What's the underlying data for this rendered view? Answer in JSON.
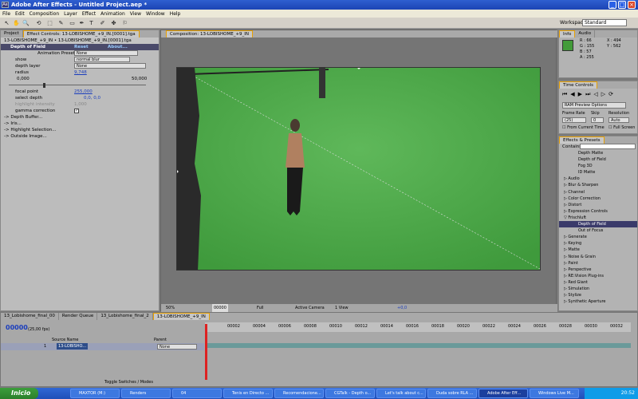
{
  "app": {
    "title": "Adobe After Effects - Untitled Project.aep *"
  },
  "window_buttons": {
    "minimize": "_",
    "maximize": "□",
    "close": "×"
  },
  "menu": [
    "File",
    "Edit",
    "Composition",
    "Layer",
    "Effect",
    "Animation",
    "View",
    "Window",
    "Help"
  ],
  "toolbar": {
    "tools": [
      "↖",
      "✋",
      "🔍",
      "⟲",
      "⬚",
      "✎",
      "▭",
      "✒",
      "T",
      "✐",
      "✤",
      "⚐"
    ],
    "workspace_label": "Workspace:",
    "workspace_value": "Standard"
  },
  "project_panel": {
    "tab_project": "Project",
    "tab_effect_controls": "Effect Controls: 13-LOBISHOME_+9_IN.[0001].tga",
    "breadcrumb": "13-LOBISHOME_+9_IN • 13-LOBISHOME_+9_IN.[0001].tga",
    "effect_name": "Depth of Field",
    "reset": "Reset",
    "about": "About...",
    "animation_presets_label": "Animation Presets:",
    "animation_presets_value": "None",
    "show_label": "show",
    "show_value": "normal blur",
    "depth_layer_label": "depth layer",
    "depth_layer_value": "None",
    "radius_label": "radius",
    "radius_value": "9,748",
    "radius_min": "0,000",
    "radius_max": "50,000",
    "focal_point_label": "focal point",
    "focal_point_value": "255,000",
    "select_depth_label": "select depth",
    "select_depth_value": "0,0, 0,0",
    "highlight_intensity_label": "highlight intensity",
    "highlight_intensity_value": "1,000",
    "gamma_correction_label": "gamma correction",
    "groups": [
      "-> Depth Buffer...",
      "-> Iris...",
      "-> Highlight Selection...",
      "-> Outside Image..."
    ]
  },
  "composition": {
    "tab": "Composition: 13-LOBISHOME_+9_IN",
    "footer": {
      "zoom": "50%",
      "time": "00000",
      "quality": "Full",
      "camera": "Active Camera",
      "views": "1 View",
      "exposure": "+0,0"
    }
  },
  "info": {
    "tab_info": "Info",
    "tab_audio": "Audio",
    "r": "R : 66",
    "g": "G : 155",
    "b": "B : 57",
    "a": "A : 255",
    "x": "X : 494",
    "y": "Y : 562",
    "swatch_color": "#429b39"
  },
  "time_controls": {
    "tab": "Time Controls",
    "ram_preview": "RAM Preview Options",
    "frame_rate_label": "Frame Rate",
    "frame_rate_value": "(25)",
    "skip_label": "Skip",
    "skip_value": "0",
    "resolution_label": "Resolution",
    "resolution_value": "Auto",
    "from_current_time": "From Current Time",
    "full_screen": "Full Screen"
  },
  "effects_presets": {
    "tab": "Effects & Presets",
    "contains_label": "Contains:",
    "items": [
      {
        "label": "Depth Matte",
        "sub": true,
        "selected": false
      },
      {
        "label": "Depth of Field",
        "sub": true,
        "selected": false
      },
      {
        "label": "Fog 3D",
        "sub": true,
        "selected": false
      },
      {
        "label": "ID Matte",
        "sub": true,
        "selected": false
      },
      {
        "label": "▷ Audio",
        "sub": false,
        "selected": false
      },
      {
        "label": "▷ Blur & Sharpen",
        "sub": false,
        "selected": false
      },
      {
        "label": "▷ Channel",
        "sub": false,
        "selected": false
      },
      {
        "label": "▷ Color Correction",
        "sub": false,
        "selected": false
      },
      {
        "label": "▷ Distort",
        "sub": false,
        "selected": false
      },
      {
        "label": "▷ Expression Controls",
        "sub": false,
        "selected": false
      },
      {
        "label": "▽ Frischluft",
        "sub": false,
        "selected": false
      },
      {
        "label": "Depth of Field",
        "sub": true,
        "selected": true
      },
      {
        "label": "Out of Focus",
        "sub": true,
        "selected": false
      },
      {
        "label": "▷ Generate",
        "sub": false,
        "selected": false
      },
      {
        "label": "▷ Keying",
        "sub": false,
        "selected": false
      },
      {
        "label": "▷ Matte",
        "sub": false,
        "selected": false
      },
      {
        "label": "▷ Noise & Grain",
        "sub": false,
        "selected": false
      },
      {
        "label": "▷ Paint",
        "sub": false,
        "selected": false
      },
      {
        "label": "▷ Perspective",
        "sub": false,
        "selected": false
      },
      {
        "label": "▷ RE:Vision Plug-ins",
        "sub": false,
        "selected": false
      },
      {
        "label": "▷ Red Giant",
        "sub": false,
        "selected": false
      },
      {
        "label": "▷ Simulation",
        "sub": false,
        "selected": false
      },
      {
        "label": "▷ Stylize",
        "sub": false,
        "selected": false
      },
      {
        "label": "▷ Synthetic Aperture",
        "sub": false,
        "selected": false
      }
    ]
  },
  "timeline": {
    "tabs": [
      "13_Lobishome_final_00",
      "Render Queue",
      "13_Lobishome_final_2",
      "13-LOBISHOME_+9_IN"
    ],
    "timecode": "00000",
    "fps": "(25,00 fps)",
    "col_source_name": "Source Name",
    "col_parent": "Parent",
    "layer_number": "1",
    "layer_name": "13-LOBISHO...",
    "parent_value": "None",
    "toggle_label": "Toggle Switches / Modes",
    "ruler": [
      "00002",
      "00004",
      "00006",
      "00008",
      "00010",
      "00012",
      "00014",
      "00016",
      "00018",
      "00020",
      "00022",
      "00024",
      "00026",
      "00028",
      "00030",
      "00032"
    ]
  },
  "taskbar": {
    "start": "Inicio",
    "tasks": [
      "MAXTOR (M:)",
      "Renders",
      "04",
      "Tenis en Directo ...",
      "Recomendacione...",
      "CGTalk - Depth o...",
      "Let's talk about c...",
      "Duda sobre RLA ...",
      "Adobe After Eff...",
      "Windows Live M..."
    ],
    "clock": "20:52"
  }
}
